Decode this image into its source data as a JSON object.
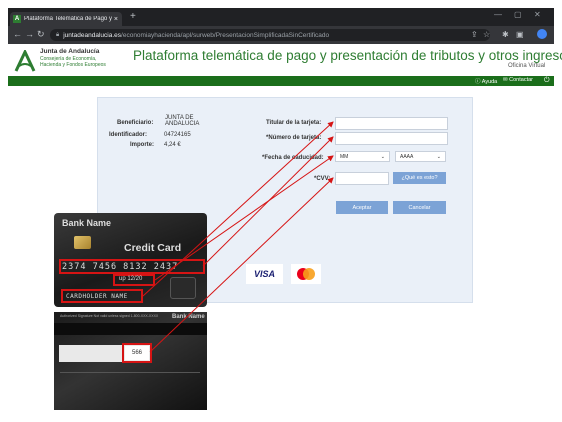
{
  "browser": {
    "tab_title": "Plataforma Telemática de Pago y",
    "tab_close": "×",
    "new_tab": "+",
    "url_host": "juntadeandalucia.es",
    "url_path": "/economiayhacienda/apl/surweb/PresentacionSimplificadaSinCertificado"
  },
  "site": {
    "org_name": "Junta de Andalucía",
    "org_department_line1": "Consejería de Economía,",
    "org_department_line2": "Hacienda y Fondos Europeos",
    "platform_title": "Plataforma telemática de pago y presentación de tributos y otros ingresos",
    "office_label": "Oficina Virtual",
    "menu": {
      "help": "Ayuda",
      "contact": "Contactar"
    }
  },
  "summary": {
    "beneficiary_label": "Beneficiario:",
    "beneficiary_value_line1": "JUNTA DE",
    "beneficiary_value_line2": "ANDALUCIA",
    "identifier_label": "Identificador:",
    "identifier_value": "04724165",
    "amount_label": "Importe:",
    "amount_value": "4,24 €"
  },
  "payment_form": {
    "holder_label": "Titular de la tarjeta:",
    "holder_value": "",
    "card_number_label": "*Número de tarjeta:",
    "card_number_value": "",
    "expiry_label": "*Fecha de caducidad:",
    "expiry_month": "MM",
    "expiry_year": "AAAA",
    "cvv_label": "*CVV:",
    "cvv_value": "",
    "cvv_help_button": "¿Qué es esto?",
    "accept_button": "Aceptar",
    "cancel_button": "Cancelar"
  },
  "brands": {
    "visa": "VISA"
  },
  "card_front": {
    "bank_name": "Bank Name",
    "card_type": "Credit Card",
    "card_number": "2374 7456 8132 2437",
    "expiry_text": "up 12/20",
    "holder_name": "CARDHOLDER NAME"
  },
  "card_back": {
    "bank_name": "Bank Name",
    "cvv": "566",
    "fine_print": "Authorized Signature   Not valid unless signed   1-800-XXX-XXXX"
  },
  "colors": {
    "brand_green": "#2e7d32",
    "dark_green_bar": "#1b6e1b",
    "highlight_red": "#d61414",
    "button_blue": "#7ca3d6",
    "card_bg": "#eaf0f8"
  }
}
